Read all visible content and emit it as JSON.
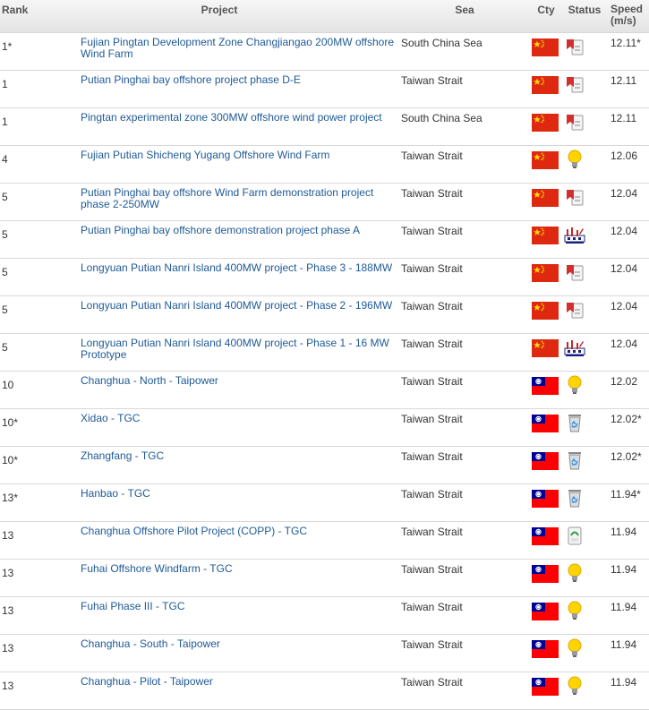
{
  "headers": {
    "rank": "Rank",
    "project": "Project",
    "sea": "Sea",
    "cty": "Cty",
    "status": "Status",
    "speed_line1": "Speed",
    "speed_line2": "(m/s)"
  },
  "rows": [
    {
      "rank": "1*",
      "project": "Fujian Pingtan Development Zone Changjiangao 200MW offshore Wind Farm",
      "sea": "South China Sea",
      "country": "china",
      "status_icon": "red-tag-icon",
      "speed": "12.11*"
    },
    {
      "rank": "1",
      "project": "Putian Pinghai bay offshore project phase D-E",
      "sea": "Taiwan Strait",
      "country": "china",
      "status_icon": "red-tag-icon",
      "speed": "12.11"
    },
    {
      "rank": "1",
      "project": "Pingtan experimental zone 300MW offshore wind power project",
      "sea": "South China Sea",
      "country": "china",
      "status_icon": "red-tag-icon",
      "speed": "12.11"
    },
    {
      "rank": "4",
      "project": "Fujian Putian Shicheng Yugang Offshore Wind Farm",
      "sea": "Taiwan Strait",
      "country": "china",
      "status_icon": "lightbulb-icon",
      "speed": "12.06"
    },
    {
      "rank": "5",
      "project": "Putian Pinghai bay offshore Wind Farm demonstration project phase 2-250MW",
      "sea": "Taiwan Strait",
      "country": "china",
      "status_icon": "red-tag-icon",
      "speed": "12.04"
    },
    {
      "rank": "5",
      "project": "Putian Pinghai bay offshore demonstration project phase A",
      "sea": "Taiwan Strait",
      "country": "china",
      "status_icon": "factory-icon",
      "speed": "12.04"
    },
    {
      "rank": "5",
      "project": "Longyuan Putian Nanri Island 400MW project - Phase 3 - 188MW",
      "sea": "Taiwan Strait",
      "country": "china",
      "status_icon": "red-tag-icon",
      "speed": "12.04"
    },
    {
      "rank": "5",
      "project": "Longyuan Putian Nanri Island 400MW project - Phase 2 - 196MW",
      "sea": "Taiwan Strait",
      "country": "china",
      "status_icon": "red-tag-icon",
      "speed": "12.04"
    },
    {
      "rank": "5",
      "project": "Longyuan Putian Nanri Island 400MW project - Phase 1 - 16 MW Prototype",
      "sea": "Taiwan Strait",
      "country": "china",
      "status_icon": "factory-icon",
      "speed": "12.04"
    },
    {
      "rank": "10",
      "project": "Changhua - North - Taipower",
      "sea": "Taiwan Strait",
      "country": "taiwan",
      "status_icon": "lightbulb-icon",
      "speed": "12.02"
    },
    {
      "rank": "10*",
      "project": "Xidao - TGC",
      "sea": "Taiwan Strait",
      "country": "taiwan",
      "status_icon": "recycle-bin-icon",
      "speed": "12.02*"
    },
    {
      "rank": "10*",
      "project": "Zhangfang - TGC",
      "sea": "Taiwan Strait",
      "country": "taiwan",
      "status_icon": "recycle-bin-icon",
      "speed": "12.02*"
    },
    {
      "rank": "13*",
      "project": "Hanbao - TGC",
      "sea": "Taiwan Strait",
      "country": "taiwan",
      "status_icon": "recycle-bin-icon",
      "speed": "11.94*"
    },
    {
      "rank": "13",
      "project": "Changhua Offshore Pilot Project (COPP) - TGC",
      "sea": "Taiwan Strait",
      "country": "taiwan",
      "status_icon": "green-tag-icon",
      "speed": "11.94"
    },
    {
      "rank": "13",
      "project": "Fuhai Offshore Windfarm - TGC",
      "sea": "Taiwan Strait",
      "country": "taiwan",
      "status_icon": "lightbulb-icon",
      "speed": "11.94"
    },
    {
      "rank": "13",
      "project": "Fuhai Phase III - TGC",
      "sea": "Taiwan Strait",
      "country": "taiwan",
      "status_icon": "lightbulb-icon",
      "speed": "11.94"
    },
    {
      "rank": "13",
      "project": "Changhua - South - Taipower",
      "sea": "Taiwan Strait",
      "country": "taiwan",
      "status_icon": "lightbulb-icon",
      "speed": "11.94"
    },
    {
      "rank": "13",
      "project": "Changhua - Pilot - Taipower",
      "sea": "Taiwan Strait",
      "country": "taiwan",
      "status_icon": "lightbulb-icon",
      "speed": "11.94"
    }
  ],
  "colors": {
    "link": "#1f5a96",
    "china_red": "#de2910",
    "china_yellow": "#ffde00",
    "taiwan_red": "#fe0000",
    "taiwan_blue": "#000095"
  }
}
